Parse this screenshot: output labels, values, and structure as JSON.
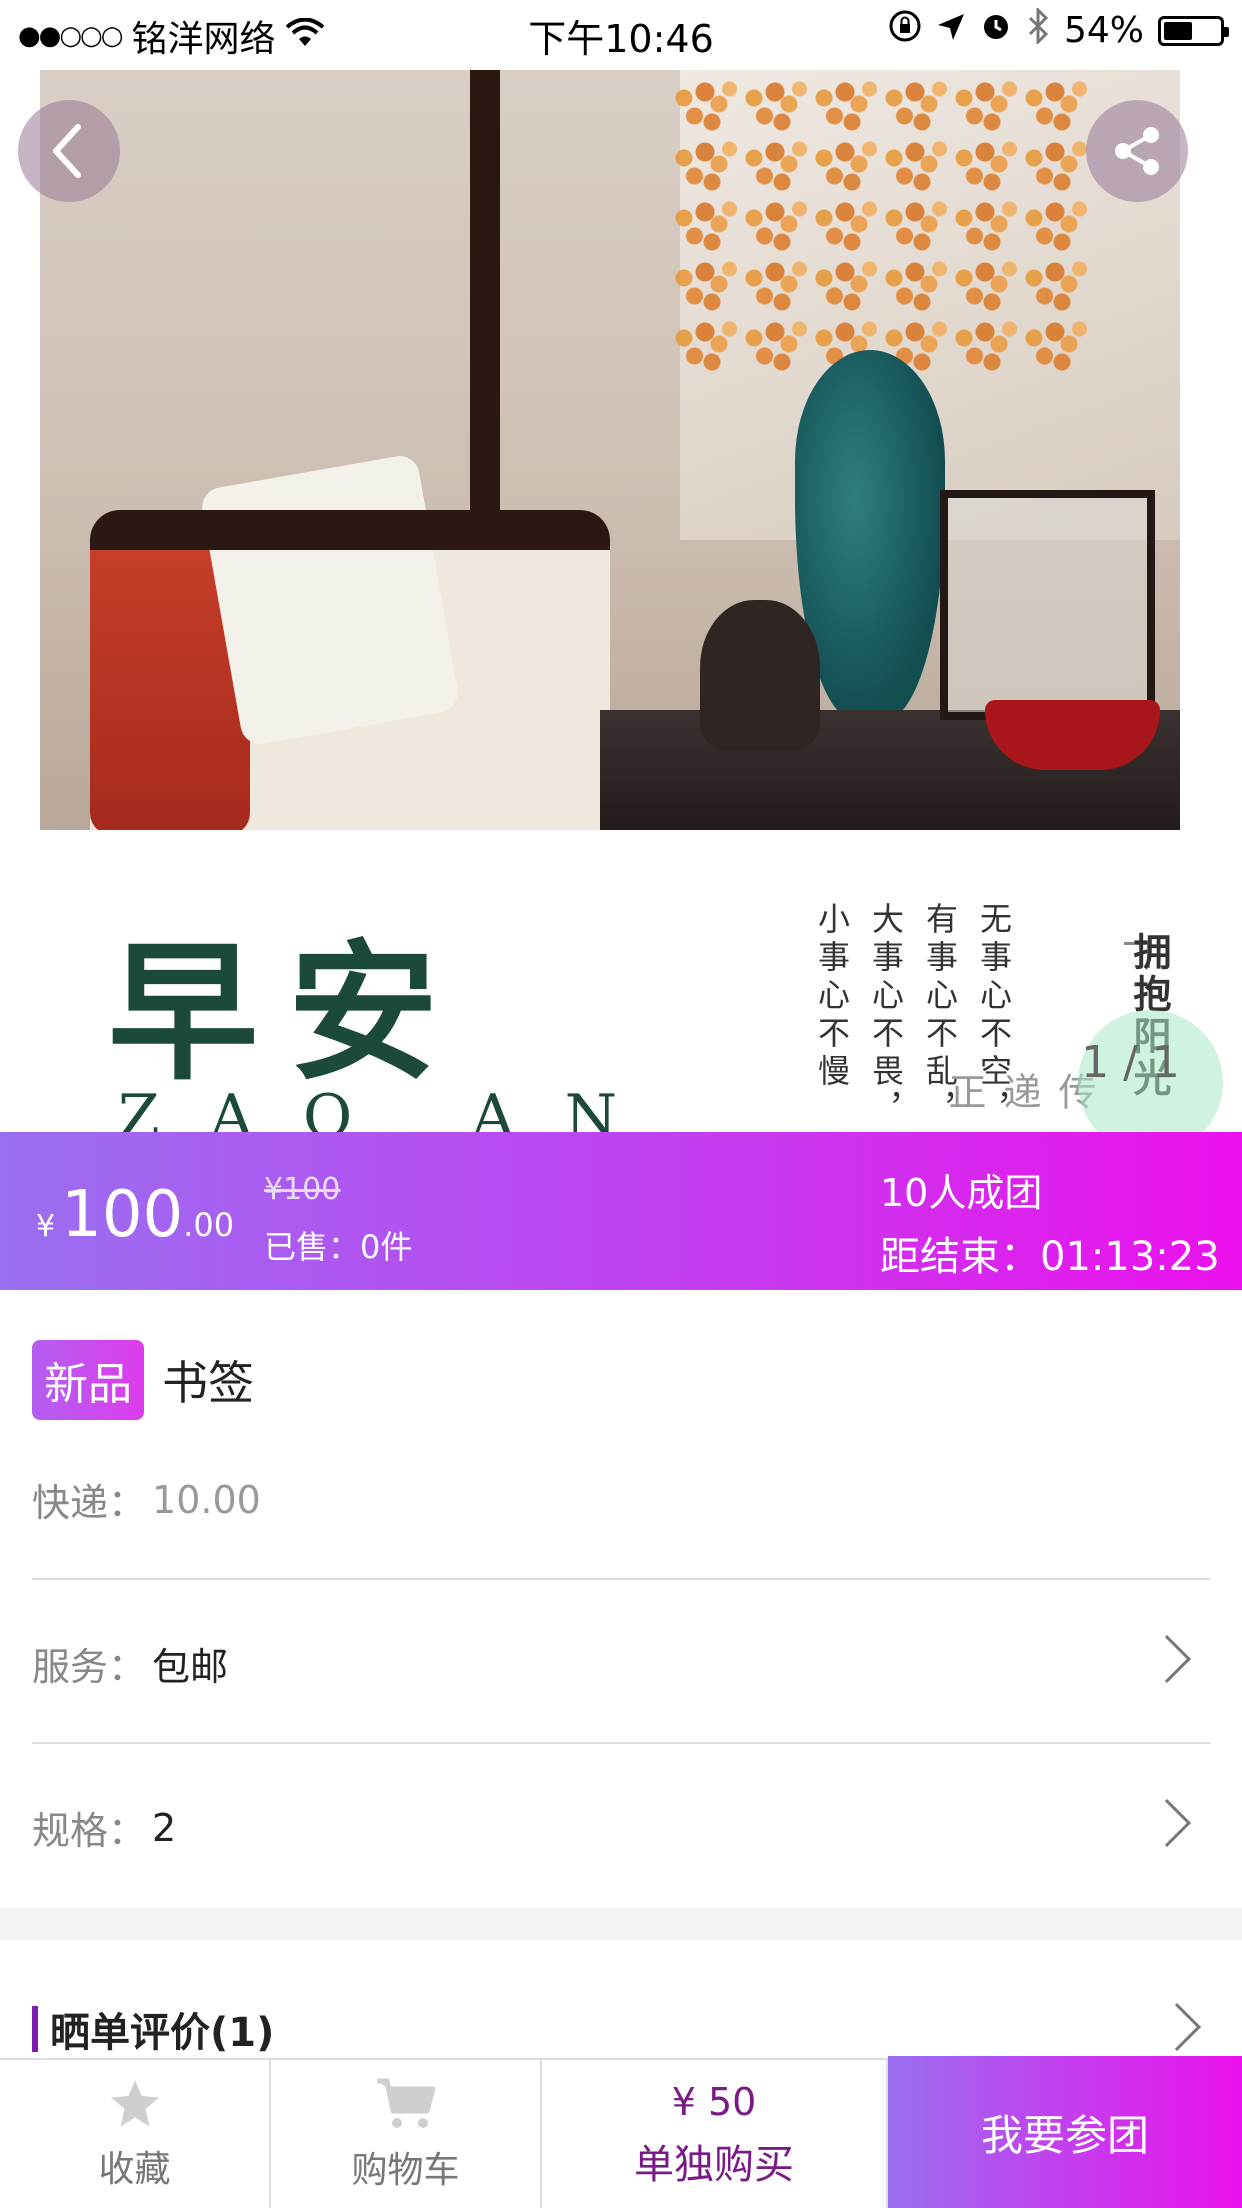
{
  "status_bar": {
    "signal": "●●○○○",
    "carrier": "铭洋网络",
    "time": "下午10:46",
    "battery": "54%"
  },
  "hero": {
    "art_title": "早安",
    "art_subtitle": "ZAO AN",
    "poem_columns": [
      "无事心不空，",
      "有事心不乱，",
      "大事心不畏，",
      "小事心不慢"
    ],
    "poem_title": "拥抱阳光",
    "poem_faint": "传递正",
    "page_indicator": "1 / 1"
  },
  "price_bar": {
    "currency": "¥",
    "price_int": "100",
    "price_dec": ".00",
    "original_price": "¥100",
    "sold": "已售：0件",
    "group_size": "10人成团",
    "countdown": "距结束：01:13:23"
  },
  "product": {
    "badge": "新品",
    "name": "书签",
    "shipping_label": "快递：",
    "shipping_value": "10.00",
    "service_label": "服务：",
    "service_value": "包邮",
    "spec_label": "规格：",
    "spec_value": "2"
  },
  "reviews": {
    "title": "晒单评价(1)"
  },
  "toolbar": {
    "favorite_label": "收藏",
    "cart_label": "购物车",
    "solo_price": "¥ 50",
    "solo_label": "单独购买",
    "join_label": "我要参团"
  },
  "colors": {
    "accent_start": "#9a6ff0",
    "accent_end": "#ec10ec",
    "solo_text": "#7a1a86"
  }
}
